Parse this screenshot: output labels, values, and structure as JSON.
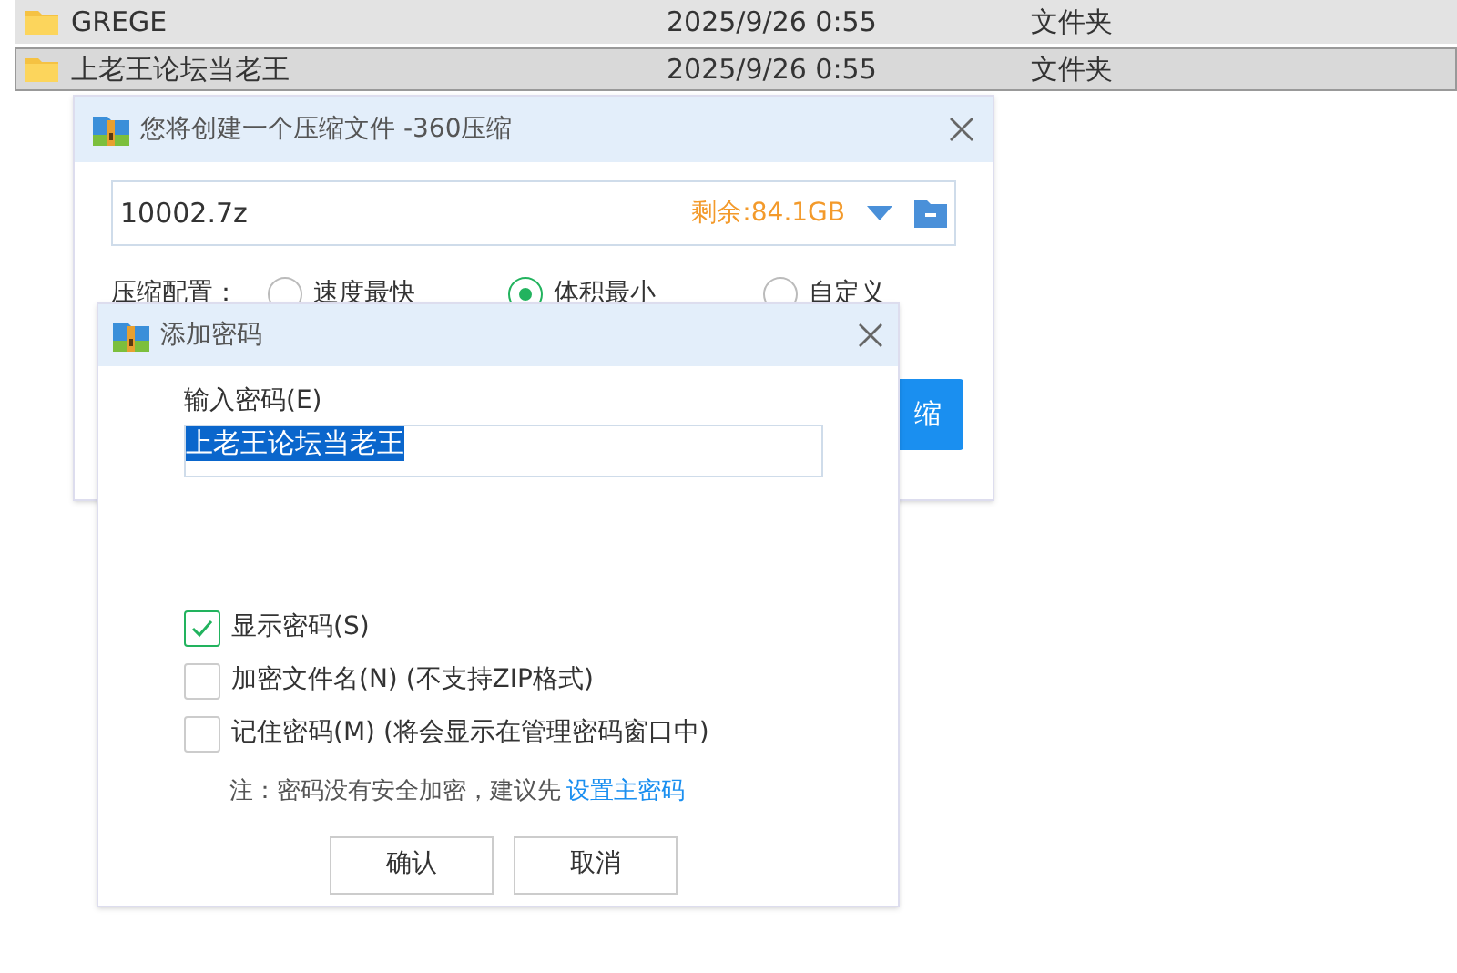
{
  "file_list": {
    "rows": [
      {
        "name": "GREGE",
        "modified": "2025/9/26 0:55",
        "type": "文件夹",
        "selected": false
      },
      {
        "name": "上老王论坛当老王",
        "modified": "2025/9/26 0:55",
        "type": "文件夹",
        "selected": true
      }
    ]
  },
  "compress_dialog": {
    "title": "您将创建一个压缩文件 -360压缩",
    "filename": "10002.7z",
    "free_space": "剩余:84.1GB",
    "config_label": "压缩配置：",
    "options": [
      {
        "label": "速度最快",
        "selected": false
      },
      {
        "label": "体积最小",
        "selected": true
      },
      {
        "label": "自定义",
        "selected": false
      }
    ],
    "start_button": "缩"
  },
  "password_dialog": {
    "title": "添加密码",
    "input_label": "输入密码(E)",
    "password": "上老王论坛当老王",
    "checkboxes": [
      {
        "label": "显示密码(S)",
        "checked": true
      },
      {
        "label": "加密文件名(N) (不支持ZIP格式)",
        "checked": false
      },
      {
        "label": "记住密码(M) (将会显示在管理密码窗口中)",
        "checked": false
      }
    ],
    "note": "注：密码没有安全加密，建议先",
    "note_link": "设置主密码",
    "buttons": [
      "确认",
      "取消"
    ]
  }
}
